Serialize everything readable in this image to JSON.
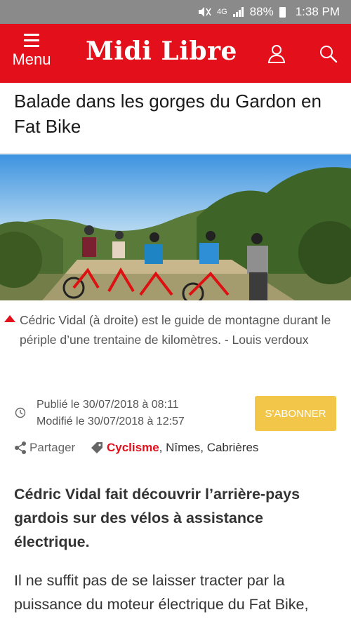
{
  "status_bar": {
    "network": "4G",
    "battery": "88%",
    "time": "1:38 PM"
  },
  "header": {
    "menu_label": "Menu",
    "logo": "Midi Libre",
    "brand_color": "#e3101b"
  },
  "article": {
    "title": "Balade dans les gorges du Gardon en Fat Bike",
    "caption": "Cédric Vidal (à droite) est le guide de montagne durant le périple d’une trentaine de kilomètres. - Louis verdoux",
    "published": "Publié le 30/07/2018 à 08:11",
    "modified": "Modifié le 30/07/2018 à 12:57",
    "subscribe_label": "S'ABONNER",
    "share_label": "Partager",
    "tags": [
      {
        "label": "Cyclisme"
      },
      {
        "label": "Nîmes"
      },
      {
        "label": "Cabrières"
      }
    ],
    "lead": "Cédric Vidal fait découvrir l’arrière-pays gardois sur des vélos à assistance électrique.",
    "body": "Il ne suffit pas de se laisser tracter par la puissance du moteur électrique du Fat Bike,"
  }
}
